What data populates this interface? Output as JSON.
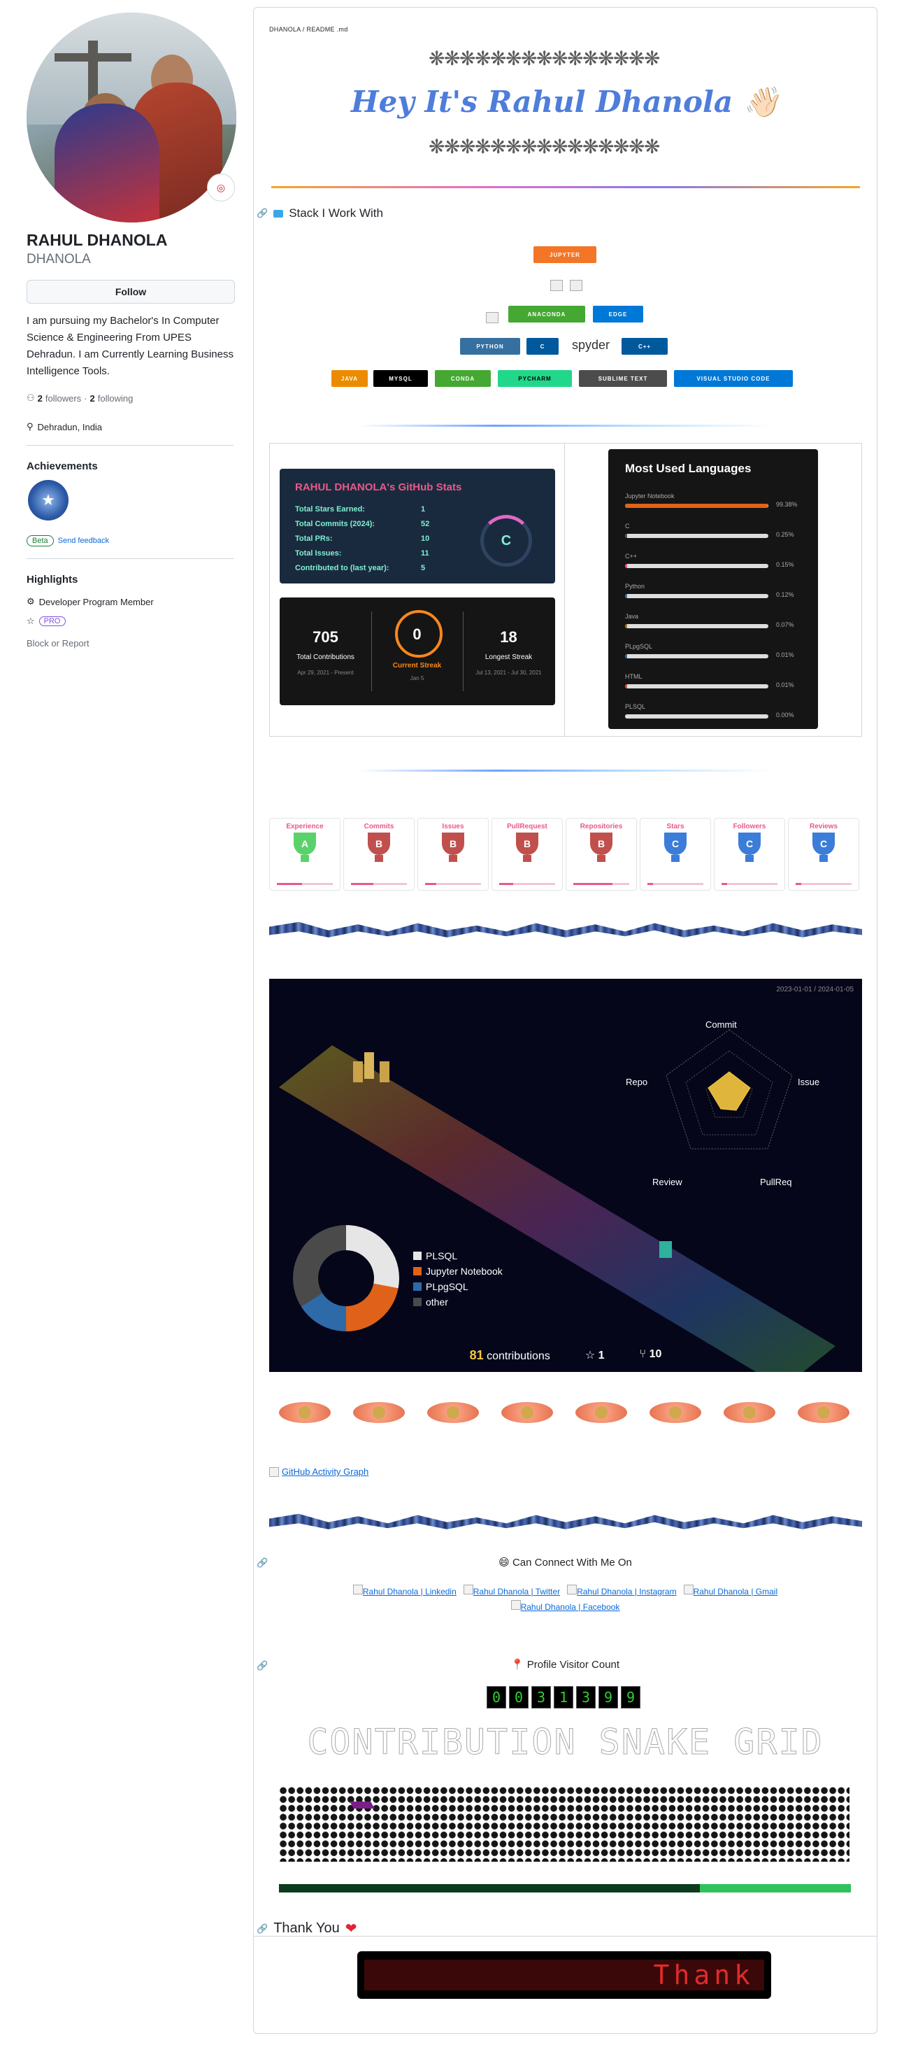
{
  "profile": {
    "name": "RAHUL DHANOLA",
    "login": "DHANOLA",
    "status_emoji": "◎",
    "follow_label": "Follow",
    "bio": "I am pursuing my Bachelor's In Computer Science & Engineering From UPES Dehradun. I am Currently Learning Business Intelligence Tools.",
    "followers_count": "2",
    "followers_label": "followers",
    "dot": "·",
    "following_count": "2",
    "following_label": "following",
    "location": "Dehradun, India",
    "achievements_title": "Achievements",
    "beta_label": "Beta",
    "feedback_label": "Send feedback",
    "highlights_title": "Highlights",
    "highlight_1": "Developer Program Member",
    "highlight_2": "PRO",
    "block_label": "Block or Report"
  },
  "readme": {
    "breadcrumb": "DHANOLA / README .md",
    "heading": "Hey It's Rahul Dhanola 👋🏻",
    "stack_title": "Stack I Work With",
    "badges": [
      {
        "label": "JUPYTER",
        "color": "#f37626"
      },
      {
        "label": "ANACONDA",
        "color": "#44a833"
      },
      {
        "label": "EDGE",
        "color": "#0078d7"
      },
      {
        "label": "PYTHON",
        "color": "#3670a0"
      },
      {
        "label": "C",
        "color": "#00599c"
      },
      {
        "label": "spyder",
        "color": "#ffffff"
      },
      {
        "label": "C++",
        "color": "#00599c"
      },
      {
        "label": "JAVA",
        "color": "#ed8b00"
      },
      {
        "label": "MYSQL",
        "color": "#000000"
      },
      {
        "label": "CONDA",
        "color": "#44a833"
      },
      {
        "label": "PYCHARM",
        "color": "#21d789"
      },
      {
        "label": "SUBLIME TEXT",
        "color": "#4c4c4c"
      },
      {
        "label": "VISUAL STUDIO CODE",
        "color": "#0078d7"
      }
    ],
    "stats_card": {
      "title": "RAHUL DHANOLA's GitHub Stats",
      "rows": [
        {
          "label": "Total Stars Earned:",
          "value": "1"
        },
        {
          "label": "Total Commits (2024):",
          "value": "52"
        },
        {
          "label": "Total PRs:",
          "value": "10"
        },
        {
          "label": "Total Issues:",
          "value": "11"
        },
        {
          "label": "Contributed to (last year):",
          "value": "5"
        }
      ],
      "rank": "C"
    },
    "streak_card": {
      "total": "705",
      "total_label": "Total Contributions",
      "total_range": "Apr 29, 2021 - Present",
      "current": "0",
      "current_label": "Current Streak",
      "current_date": "Jan 5",
      "longest": "18",
      "longest_label": "Longest Streak",
      "longest_range": "Jul 13, 2021 - Jul 30, 2021"
    },
    "languages_card": {
      "title": "Most Used Languages",
      "items": [
        {
          "name": "Jupyter Notebook",
          "pct": "99.38%",
          "frac": 0.9938,
          "color": "#e0621a"
        },
        {
          "name": "C",
          "pct": "0.25%",
          "frac": 0.0025,
          "color": "#555555"
        },
        {
          "name": "C++",
          "pct": "0.15%",
          "frac": 0.0015,
          "color": "#f34b7d"
        },
        {
          "name": "Python",
          "pct": "0.12%",
          "frac": 0.0012,
          "color": "#3572a5"
        },
        {
          "name": "Java",
          "pct": "0.07%",
          "frac": 0.0007,
          "color": "#b07219"
        },
        {
          "name": "PLpgSQL",
          "pct": "0.01%",
          "frac": 0.0001,
          "color": "#336790"
        },
        {
          "name": "HTML",
          "pct": "0.01%",
          "frac": 0.0001,
          "color": "#e34c26"
        },
        {
          "name": "PLSQL",
          "pct": "0.00%",
          "frac": 0.0,
          "color": "#dad8d8"
        }
      ]
    },
    "trophies": [
      {
        "title": "Experience",
        "rank": "A",
        "color": "#5bd16b",
        "progress": 0.45
      },
      {
        "title": "Commits",
        "rank": "B",
        "color": "#c0504d",
        "progress": 0.4
      },
      {
        "title": "Issues",
        "rank": "B",
        "color": "#c0504d",
        "progress": 0.2
      },
      {
        "title": "PullRequest",
        "rank": "B",
        "color": "#c0504d",
        "progress": 0.25
      },
      {
        "title": "Repositories",
        "rank": "B",
        "color": "#c0504d",
        "progress": 0.7
      },
      {
        "title": "Stars",
        "rank": "C",
        "color": "#3b7dd8",
        "progress": 0.1
      },
      {
        "title": "Followers",
        "rank": "C",
        "color": "#3b7dd8",
        "progress": 0.1
      },
      {
        "title": "Reviews",
        "rank": "C",
        "color": "#3b7dd8",
        "progress": 0.1
      }
    ],
    "iso": {
      "date_range": "2023-01-01 / 2024-01-05",
      "radar_labels": {
        "top": "Commit",
        "right": "Issue",
        "br": "PullReq",
        "bl": "Review",
        "left": "Repo"
      },
      "legend": [
        {
          "label": "PLSQL",
          "color": "#e6e6e6"
        },
        {
          "label": "Jupyter Notebook",
          "color": "#e0621a"
        },
        {
          "label": "PLpgSQL",
          "color": "#2f6aa8"
        },
        {
          "label": "other",
          "color": "#4a4a4a"
        }
      ],
      "contributions": "81",
      "contributions_label": "contributions",
      "stars": "1",
      "forks": "10"
    },
    "activity_graph": "GitHub Activity Graph",
    "connect_title": "Can Connect With Me On",
    "connect_links": [
      "Rahul Dhanola | Linkedin",
      "Rahul Dhanola | Twitter",
      "Rahul Dhanola | Instagram",
      "Rahul Dhanola | Gmail",
      "Rahul Dhanola | Facebook"
    ],
    "visitor_title": "Profile Visitor Count",
    "visitor_digits": [
      "0",
      "0",
      "3",
      "1",
      "3",
      "9",
      "9"
    ],
    "snake_title": "CONTRIBUTION SNAKE GRID",
    "thank_title": "Thank You",
    "thank_led": "Thank"
  }
}
